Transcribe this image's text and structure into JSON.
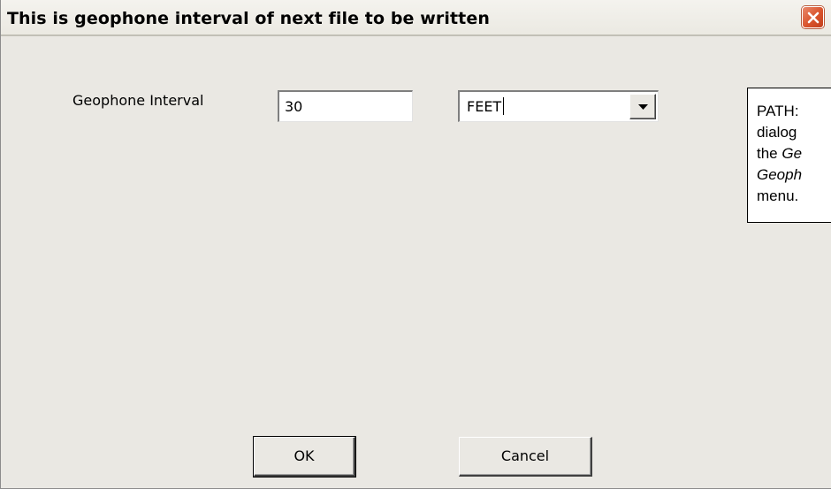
{
  "window": {
    "title": "This is geophone interval of next file to be written"
  },
  "form": {
    "interval_label": "Geophone Interval",
    "interval_value": "30",
    "units_value": "FEET"
  },
  "note": {
    "lines": [
      "PATH:",
      "dialog",
      "the Ge",
      "Geoph",
      "menu."
    ]
  },
  "buttons": {
    "ok_label": "OK",
    "cancel_label": "Cancel"
  },
  "icons": {
    "close": "close-icon",
    "dropdown": "chevron-down-icon"
  },
  "colors": {
    "window_bg": "#eae8e3",
    "close_button": "#d9532c"
  }
}
